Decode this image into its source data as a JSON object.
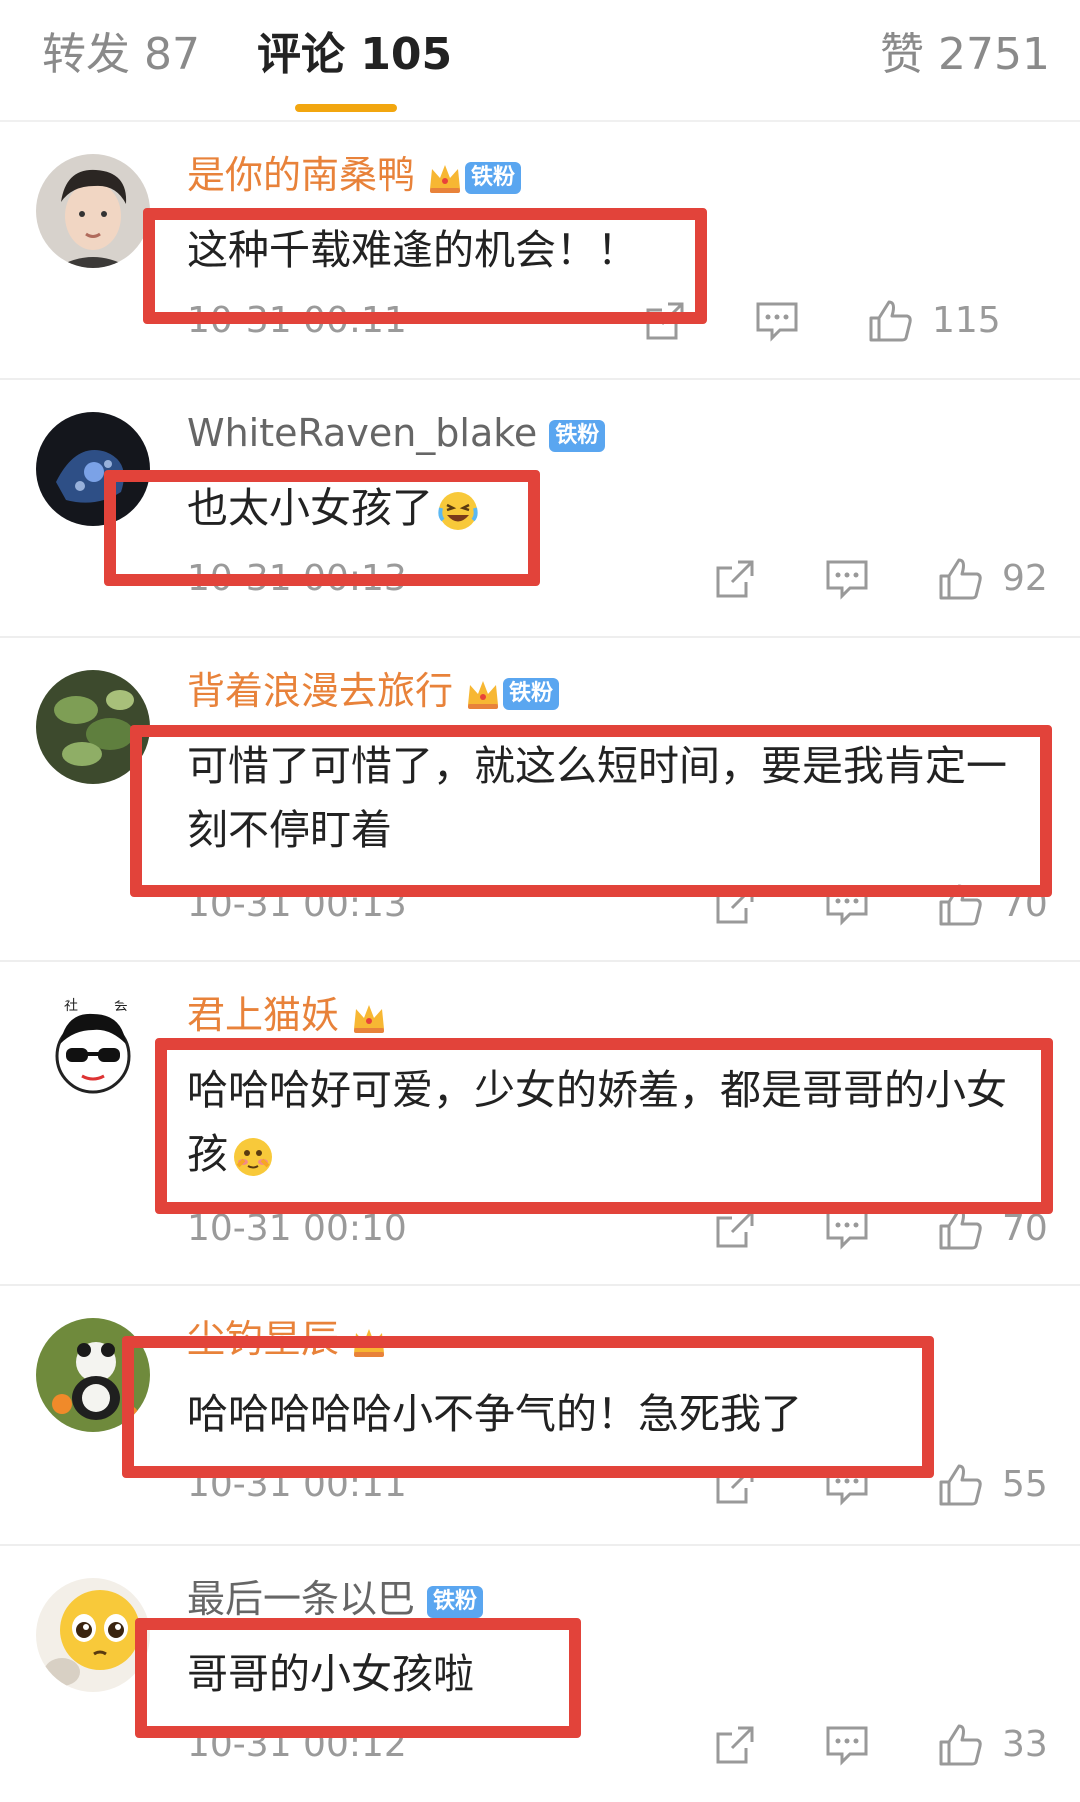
{
  "tabs": {
    "repost": "转发 87",
    "comments": "评论 105",
    "likes": "赞 2751"
  },
  "colors": {
    "accent_underline": "#f2a60f",
    "vip_name": "#e8823a",
    "fan_badge": "#5aa6f0",
    "annotation_box": "#e2433a"
  },
  "badge_label": "铁粉",
  "comments": [
    {
      "username": "是你的南桑鸭",
      "vip": true,
      "fan_badge": true,
      "text": "这种千载难逢的机会！！",
      "timestamp": "10-31 00:11",
      "likes": "115"
    },
    {
      "username": "WhiteRaven_blake",
      "vip": false,
      "fan_badge": true,
      "text": "也太小女孩了",
      "emoji": "laughing-tears-emoji",
      "timestamp": "10-31 00:13",
      "likes": "92"
    },
    {
      "username": "背着浪漫去旅行",
      "vip": true,
      "fan_badge": true,
      "text": "可惜了可惜了，就这么短时间，要是我肯定一刻不停盯着",
      "timestamp": "10-31 00:13",
      "likes": "70"
    },
    {
      "username": "君上猫妖",
      "vip": true,
      "fan_badge": false,
      "text": "哈哈哈好可爱，少女的娇羞，都是哥哥的小女孩",
      "emoji": "shy-blush-emoji",
      "timestamp": "10-31 00:10",
      "likes": "70"
    },
    {
      "username": "尘钓星辰",
      "vip": true,
      "fan_badge": false,
      "text": "哈哈哈哈哈小不争气的！急死我了",
      "timestamp": "10-31 00:11",
      "likes": "55"
    },
    {
      "username": "最后一条以巴",
      "vip": false,
      "fan_badge": true,
      "text": "哥哥的小女孩啦",
      "timestamp": "10-31 00:12",
      "likes": "33"
    }
  ],
  "icons": {
    "repost": "share-out-icon",
    "reply": "comment-bubble-icon",
    "like": "thumbs-up-icon"
  }
}
